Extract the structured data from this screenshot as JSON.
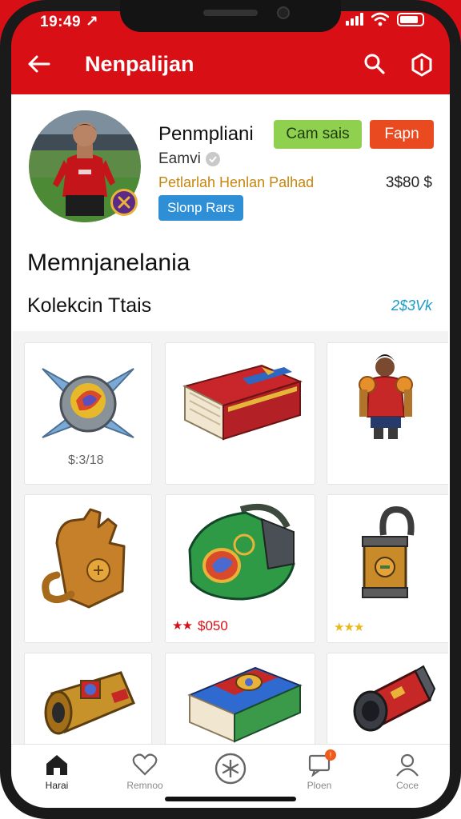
{
  "status": {
    "time": "19:49 ↗"
  },
  "header": {
    "title": "Nenpalijan"
  },
  "profile": {
    "name": "Penmpliani",
    "button_green": "Cam sais",
    "button_orange": "Fapn",
    "sub": "Eamvi",
    "team": "Petlarlah Henlan Palhad",
    "value": "3$80 $",
    "button_blue": "Slonp Rars",
    "section_heading": "Memnjanelania",
    "collection_heading": "Kolekcin Ttais",
    "collection_count": "2$3Vk"
  },
  "items": [
    {
      "name": "spiked orb",
      "price": "$:3/18"
    },
    {
      "name": "red book",
      "price": ""
    },
    {
      "name": "player figure",
      "price": ""
    },
    {
      "name": "bronze gauntlet",
      "price": ""
    },
    {
      "name": "green bag",
      "price": "$050",
      "rating": 2
    },
    {
      "name": "lantern",
      "price": "",
      "rating": 3
    },
    {
      "name": "gold scroll",
      "price": ""
    },
    {
      "name": "tome",
      "price": ""
    },
    {
      "name": "canister",
      "price": ""
    }
  ],
  "nav": {
    "items": [
      {
        "label": "Harai",
        "icon": "home-icon"
      },
      {
        "label": "Remnoo",
        "icon": "heart-icon"
      },
      {
        "label": "",
        "icon": "asterisk-icon"
      },
      {
        "label": "Ploen",
        "icon": "notification-icon"
      },
      {
        "label": "Coce",
        "icon": "profile-icon"
      }
    ],
    "badge": "!"
  },
  "colors": {
    "header": "#d81016",
    "green": "#8fd14f",
    "orange": "#ea4a20",
    "blue": "#2e8fd6",
    "gold": "#c7860f"
  }
}
